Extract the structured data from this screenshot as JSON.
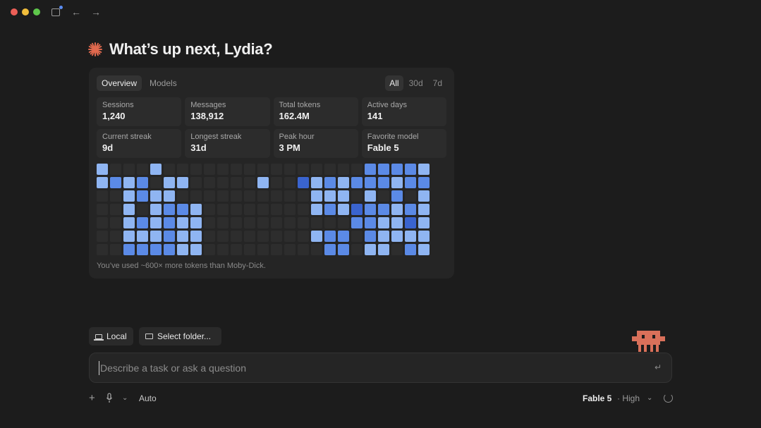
{
  "greeting": {
    "text": "What’s up next, Lydia?",
    "icon": "spark-icon",
    "accent": "#e0694e"
  },
  "stats_card": {
    "tabs": [
      {
        "label": "Overview",
        "active": true
      },
      {
        "label": "Models",
        "active": false
      }
    ],
    "ranges": [
      {
        "label": "All",
        "active": true
      },
      {
        "label": "30d",
        "active": false
      },
      {
        "label": "7d",
        "active": false
      }
    ],
    "stats": [
      {
        "label": "Sessions",
        "value": "1,240"
      },
      {
        "label": "Messages",
        "value": "138,912"
      },
      {
        "label": "Total tokens",
        "value": "162.4M"
      },
      {
        "label": "Active days",
        "value": "141"
      },
      {
        "label": "Current streak",
        "value": "9d"
      },
      {
        "label": "Longest streak",
        "value": "31d"
      },
      {
        "label": "Peak hour",
        "value": "3 PM"
      },
      {
        "label": "Favorite model",
        "value": "Fable 5"
      }
    ],
    "heatmap": {
      "rows": [
        "3000300000000000000022223",
        "3232033000003001323222322",
        "0032330000000000333030203",
        "0030322300000000323122323",
        "0032323300000000000223313",
        "0033323300000000322023333",
        "0022223300000000022033023"
      ],
      "palette": {
        "0": "#2d2d2d",
        "1": "#3a64cf",
        "2": "#5b8ae6",
        "3": "#8fb5f2"
      }
    },
    "footnote": "You’ve used ~600× more tokens than Moby-Dick."
  },
  "environment": {
    "local_label": "Local",
    "folder_label": "Select folder..."
  },
  "composer": {
    "placeholder": "Describe a task or ask a question",
    "value": "",
    "enter_icon": "return-icon"
  },
  "bottom_bar": {
    "mode": "Auto",
    "model": "Fable 5",
    "effort": "· High"
  }
}
